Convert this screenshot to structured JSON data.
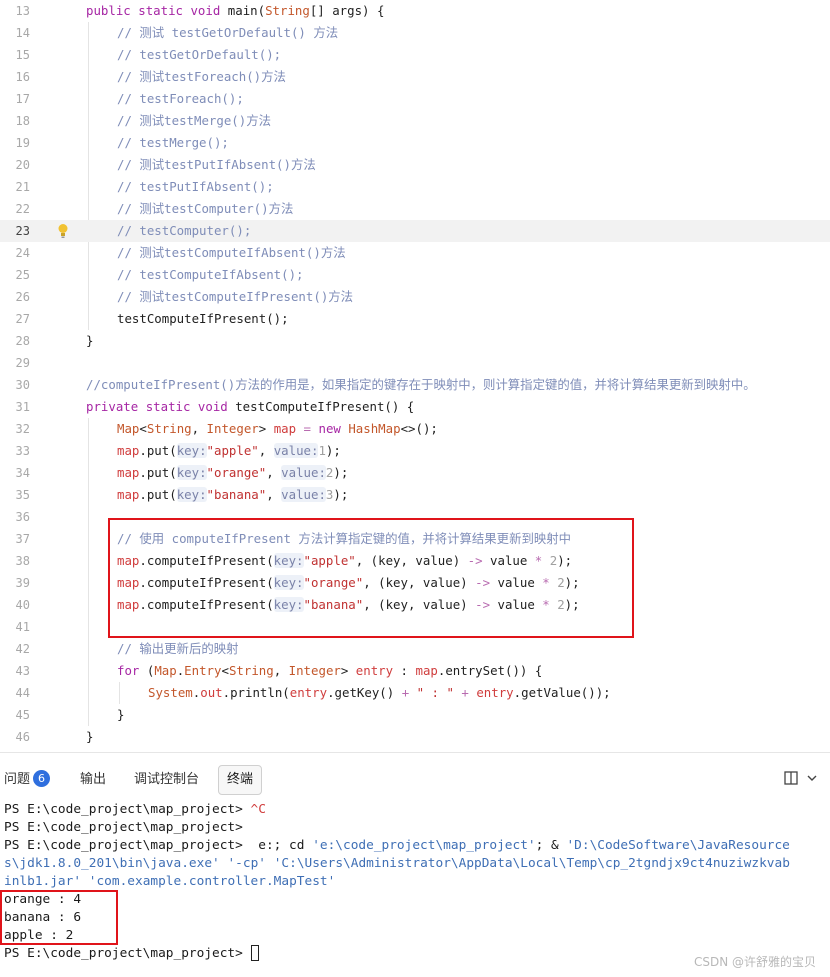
{
  "editor": {
    "lines": [
      {
        "num": "13",
        "indent": 0,
        "tokens": [
          [
            "kw",
            "public"
          ],
          [
            "",
            " "
          ],
          [
            "kw",
            "static"
          ],
          [
            "",
            " "
          ],
          [
            "kw",
            "void"
          ],
          [
            "",
            " main("
          ],
          [
            "ty",
            "String"
          ],
          [
            "",
            "[] args) {"
          ]
        ]
      },
      {
        "num": "14",
        "indent": 1,
        "tokens": [
          [
            "cm",
            "// 测试 testGetOrDefault() 方法"
          ]
        ]
      },
      {
        "num": "15",
        "indent": 1,
        "tokens": [
          [
            "cm",
            "// testGetOrDefault();"
          ]
        ]
      },
      {
        "num": "16",
        "indent": 1,
        "tokens": [
          [
            "cm",
            "// 测试testForeach()方法"
          ]
        ]
      },
      {
        "num": "17",
        "indent": 1,
        "tokens": [
          [
            "cm",
            "// testForeach();"
          ]
        ]
      },
      {
        "num": "18",
        "indent": 1,
        "tokens": [
          [
            "cm",
            "// 测试testMerge()方法"
          ]
        ]
      },
      {
        "num": "19",
        "indent": 1,
        "tokens": [
          [
            "cm",
            "// testMerge();"
          ]
        ]
      },
      {
        "num": "20",
        "indent": 1,
        "tokens": [
          [
            "cm",
            "// 测试testPutIfAbsent()方法"
          ]
        ]
      },
      {
        "num": "21",
        "indent": 1,
        "tokens": [
          [
            "cm",
            "// testPutIfAbsent();"
          ]
        ]
      },
      {
        "num": "22",
        "indent": 1,
        "tokens": [
          [
            "cm",
            "// 测试testComputer()方法"
          ]
        ]
      },
      {
        "num": "23",
        "indent": 1,
        "current": true,
        "tokens": [
          [
            "cm",
            "// testComputer();"
          ]
        ]
      },
      {
        "num": "24",
        "indent": 1,
        "tokens": [
          [
            "cm",
            "// 测试testComputeIfAbsent()方法"
          ]
        ]
      },
      {
        "num": "25",
        "indent": 1,
        "tokens": [
          [
            "cm",
            "// testComputeIfAbsent();"
          ]
        ]
      },
      {
        "num": "26",
        "indent": 1,
        "tokens": [
          [
            "cm",
            "// 测试testComputeIfPresent()方法"
          ]
        ]
      },
      {
        "num": "27",
        "indent": 1,
        "tokens": [
          [
            "",
            "testComputeIfPresent();"
          ]
        ]
      },
      {
        "num": "28",
        "indent": 0,
        "tokens": [
          [
            "",
            "}"
          ]
        ]
      },
      {
        "num": "29",
        "indent": 0,
        "tokens": []
      },
      {
        "num": "30",
        "indent": 0,
        "tokens": [
          [
            "cm",
            "//computeIfPresent()方法的作用是，如果指定的键存在于映射中，则计算指定键的值，并将计算结果更新到映射中。"
          ]
        ]
      },
      {
        "num": "31",
        "indent": 0,
        "tokens": [
          [
            "kw",
            "private"
          ],
          [
            "",
            " "
          ],
          [
            "kw",
            "static"
          ],
          [
            "",
            " "
          ],
          [
            "kw",
            "void"
          ],
          [
            "",
            " testComputeIfPresent() {"
          ]
        ]
      },
      {
        "num": "32",
        "indent": 1,
        "tokens": [
          [
            "ty",
            "Map"
          ],
          [
            "",
            "<"
          ],
          [
            "ty",
            "String"
          ],
          [
            "",
            ", "
          ],
          [
            "ty",
            "Integer"
          ],
          [
            "",
            "> "
          ],
          [
            "vr",
            "map"
          ],
          [
            "",
            " "
          ],
          [
            "op",
            "="
          ],
          [
            "",
            " "
          ],
          [
            "kw",
            "new"
          ],
          [
            "",
            " "
          ],
          [
            "ty",
            "HashMap"
          ],
          [
            "",
            "<>();"
          ]
        ]
      },
      {
        "num": "33",
        "indent": 1,
        "tokens": [
          [
            "vr",
            "map"
          ],
          [
            "",
            ".put("
          ],
          [
            "hint",
            "key:"
          ],
          [
            "st",
            "\"apple\""
          ],
          [
            "",
            ", "
          ],
          [
            "hint",
            "value:"
          ],
          [
            "nm",
            "1"
          ],
          [
            "",
            ");"
          ]
        ]
      },
      {
        "num": "34",
        "indent": 1,
        "tokens": [
          [
            "vr",
            "map"
          ],
          [
            "",
            ".put("
          ],
          [
            "hint",
            "key:"
          ],
          [
            "st",
            "\"orange\""
          ],
          [
            "",
            ", "
          ],
          [
            "hint",
            "value:"
          ],
          [
            "nm",
            "2"
          ],
          [
            "",
            ");"
          ]
        ]
      },
      {
        "num": "35",
        "indent": 1,
        "tokens": [
          [
            "vr",
            "map"
          ],
          [
            "",
            ".put("
          ],
          [
            "hint",
            "key:"
          ],
          [
            "st",
            "\"banana\""
          ],
          [
            "",
            ", "
          ],
          [
            "hint",
            "value:"
          ],
          [
            "nm",
            "3"
          ],
          [
            "",
            ");"
          ]
        ]
      },
      {
        "num": "36",
        "indent": 0,
        "tokens": []
      },
      {
        "num": "37",
        "indent": 1,
        "tokens": [
          [
            "cm",
            "// 使用 computeIfPresent 方法计算指定键的值，并将计算结果更新到映射中"
          ]
        ]
      },
      {
        "num": "38",
        "indent": 1,
        "tokens": [
          [
            "vr",
            "map"
          ],
          [
            "",
            ".computeIfPresent("
          ],
          [
            "hint",
            "key:"
          ],
          [
            "st",
            "\"apple\""
          ],
          [
            "",
            ", (key, value) "
          ],
          [
            "op",
            "->"
          ],
          [
            "",
            " value "
          ],
          [
            "op",
            "*"
          ],
          [
            "",
            " "
          ],
          [
            "nm",
            "2"
          ],
          [
            "",
            ");"
          ]
        ]
      },
      {
        "num": "39",
        "indent": 1,
        "tokens": [
          [
            "vr",
            "map"
          ],
          [
            "",
            ".computeIfPresent("
          ],
          [
            "hint",
            "key:"
          ],
          [
            "st",
            "\"orange\""
          ],
          [
            "",
            ", (key, value) "
          ],
          [
            "op",
            "->"
          ],
          [
            "",
            " value "
          ],
          [
            "op",
            "*"
          ],
          [
            "",
            " "
          ],
          [
            "nm",
            "2"
          ],
          [
            "",
            ");"
          ]
        ]
      },
      {
        "num": "40",
        "indent": 1,
        "tokens": [
          [
            "vr",
            "map"
          ],
          [
            "",
            ".computeIfPresent("
          ],
          [
            "hint",
            "key:"
          ],
          [
            "st",
            "\"banana\""
          ],
          [
            "",
            ", (key, value) "
          ],
          [
            "op",
            "->"
          ],
          [
            "",
            " value "
          ],
          [
            "op",
            "*"
          ],
          [
            "",
            " "
          ],
          [
            "nm",
            "2"
          ],
          [
            "",
            ");"
          ]
        ]
      },
      {
        "num": "41",
        "indent": 0,
        "tokens": []
      },
      {
        "num": "42",
        "indent": 1,
        "tokens": [
          [
            "cm",
            "// 输出更新后的映射"
          ]
        ]
      },
      {
        "num": "43",
        "indent": 1,
        "tokens": [
          [
            "kw",
            "for"
          ],
          [
            "",
            " ("
          ],
          [
            "ty",
            "Map"
          ],
          [
            "",
            "."
          ],
          [
            "ty",
            "Entry"
          ],
          [
            "",
            "<"
          ],
          [
            "ty",
            "String"
          ],
          [
            "",
            ", "
          ],
          [
            "ty",
            "Integer"
          ],
          [
            "",
            "> "
          ],
          [
            "vr",
            "entry"
          ],
          [
            "",
            " : "
          ],
          [
            "vr",
            "map"
          ],
          [
            "",
            ".entrySet()) {"
          ]
        ]
      },
      {
        "num": "44",
        "indent": 2,
        "tokens": [
          [
            "ty",
            "System"
          ],
          [
            "",
            "."
          ],
          [
            "vr",
            "out"
          ],
          [
            "",
            ".println("
          ],
          [
            "vr",
            "entry"
          ],
          [
            "",
            ".getKey() "
          ],
          [
            "op",
            "+"
          ],
          [
            "",
            " "
          ],
          [
            "st",
            "\" : \""
          ],
          [
            "",
            " "
          ],
          [
            "op",
            "+"
          ],
          [
            "",
            " "
          ],
          [
            "vr",
            "entry"
          ],
          [
            "",
            ".getValue());"
          ]
        ]
      },
      {
        "num": "45",
        "indent": 1,
        "tokens": [
          [
            "",
            "}"
          ]
        ]
      },
      {
        "num": "46",
        "indent": 0,
        "tokens": [
          [
            "",
            "}"
          ]
        ]
      }
    ]
  },
  "panel": {
    "tabs": {
      "problems": "问题",
      "problems_count": "6",
      "output": "输出",
      "debug_console": "调试控制台",
      "terminal": "终端"
    },
    "icons": {
      "split": "split-layout-icon",
      "chevron": "chevron-down-icon"
    }
  },
  "terminal": {
    "lines": [
      [
        [
          "",
          "PS E:\\code_project\\map_project> "
        ],
        [
          "tc",
          "^C"
        ]
      ],
      [
        [
          "",
          "PS E:\\code_project\\map_project> "
        ]
      ],
      [
        [
          "",
          "PS E:\\code_project\\map_project>  e:; cd "
        ],
        [
          "tq",
          "'e:\\code_project\\map_project'"
        ],
        [
          "",
          "; & "
        ],
        [
          "tq",
          "'D:\\CodeSoftware\\JavaResource"
        ]
      ],
      [
        [
          "tq",
          "s\\jdk1.8.0_201\\bin\\java.exe'"
        ],
        [
          "",
          " "
        ],
        [
          "tq",
          "'-cp'"
        ],
        [
          "",
          " "
        ],
        [
          "tq",
          "'C:\\Users\\Administrator\\AppData\\Local\\Temp\\cp_2tgndjx9ct4nuziwzkvab"
        ]
      ],
      [
        [
          "tq",
          "inlb1.jar'"
        ],
        [
          "",
          " "
        ],
        [
          "tq",
          "'com.example.controller.MapTest'"
        ]
      ],
      [
        [
          "",
          "orange : 4"
        ]
      ],
      [
        [
          "",
          "banana : 6"
        ]
      ],
      [
        [
          "",
          "apple : 2"
        ]
      ],
      [
        [
          "",
          "PS E:\\code_project\\map_project> "
        ]
      ]
    ]
  },
  "watermark": "CSDN @许舒雅的宝贝",
  "colors": {
    "highlight_box": "#e0141a",
    "badge": "#2f6fde"
  }
}
